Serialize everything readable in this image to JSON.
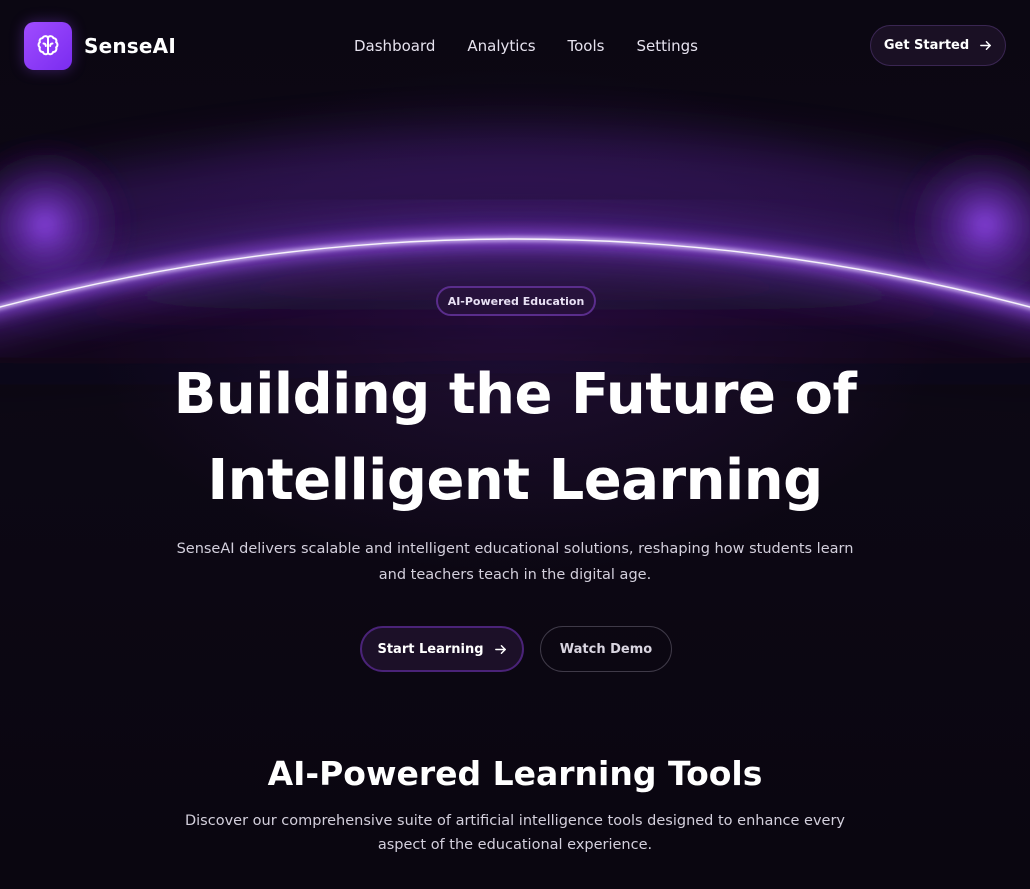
{
  "brand": {
    "name": "SenseAI",
    "logo_icon": "brain-icon",
    "accent": "#8b3cf7"
  },
  "nav": {
    "links": [
      {
        "label": "Dashboard"
      },
      {
        "label": "Analytics"
      },
      {
        "label": "Tools"
      },
      {
        "label": "Settings"
      }
    ],
    "cta_label": "Get Started",
    "cta_icon": "arrow-right-icon"
  },
  "hero": {
    "badge": "AI-Powered Education",
    "title_line1": "Building the Future of",
    "title_line2": "Intelligent Learning",
    "subtitle_line1": "SenseAI delivers scalable and intelligent educational solutions, reshaping how students learn",
    "subtitle_line2": "and teachers teach in the digital age.",
    "primary_button": "Start Learning",
    "primary_icon": "arrow-right-icon",
    "secondary_button": "Watch Demo"
  },
  "tools_section": {
    "title": "AI-Powered Learning Tools",
    "subtitle_line1": "Discover our comprehensive suite of artificial intelligence tools designed to enhance every",
    "subtitle_line2": "aspect of the educational experience."
  },
  "colors": {
    "background": "#0a0610",
    "glow_arc": "#9b4dff",
    "button_bg": "#1c1028"
  }
}
